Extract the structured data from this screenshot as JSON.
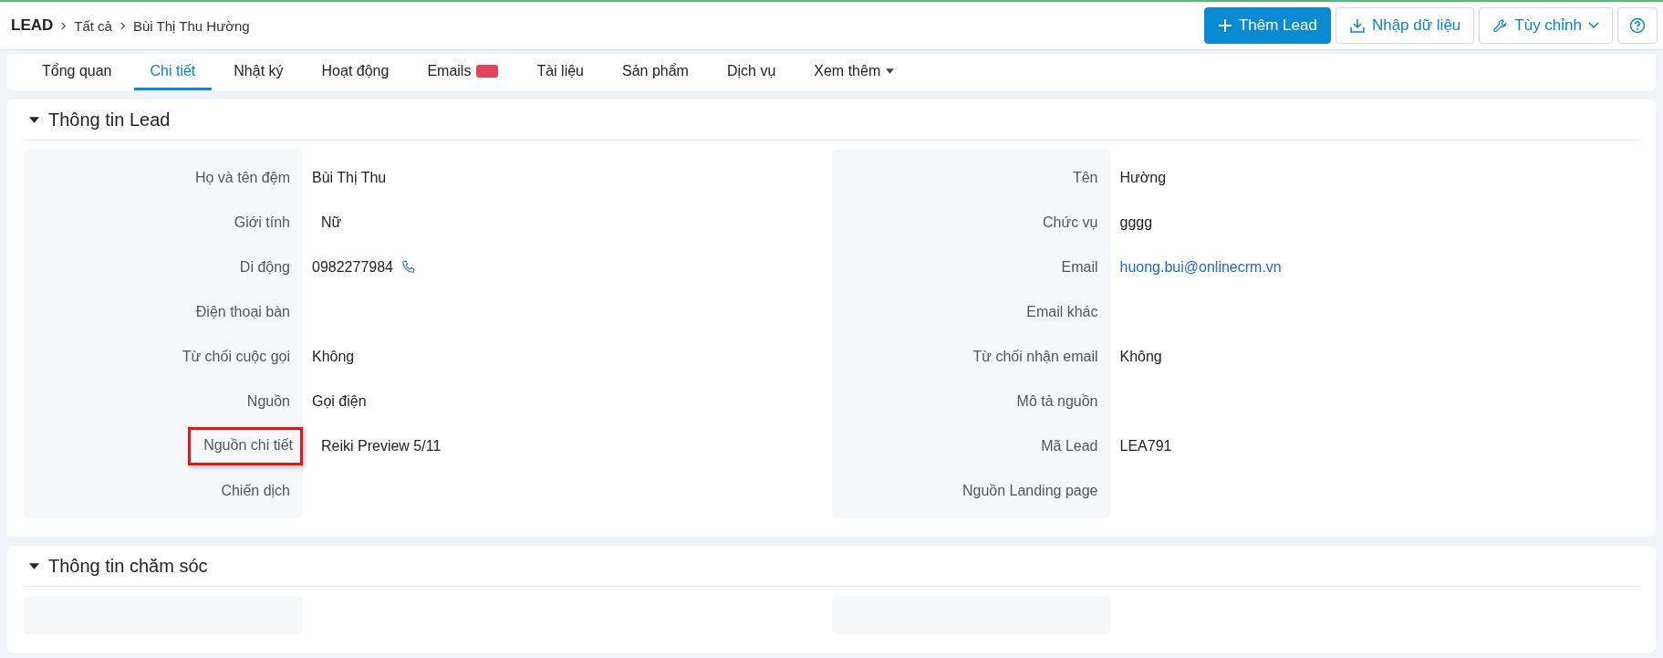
{
  "breadcrumb": {
    "module": "LEAD",
    "items": [
      "Tất cả",
      "Bùi Thị Thu Hường"
    ]
  },
  "actions": [
    {
      "kind": "add",
      "label": "Thêm Lead"
    },
    {
      "kind": "import",
      "label": "Nhập dữ liệu"
    },
    {
      "kind": "customize",
      "label": "Tùy chỉnh"
    },
    {
      "kind": "help"
    }
  ],
  "tabs": [
    {
      "label": "Tổng quan",
      "selected": false
    },
    {
      "label": "Chi tiết",
      "selected": true
    },
    {
      "label": "Nhật ký",
      "selected": false
    },
    {
      "label": "Hoạt động",
      "selected": false
    },
    {
      "label": "Emails",
      "selected": false,
      "badge": true
    },
    {
      "label": "Tài liệu",
      "selected": false
    },
    {
      "label": "Sản phẩm",
      "selected": false
    },
    {
      "label": "Dịch vụ",
      "selected": false
    },
    {
      "label": "Xem thêm",
      "selected": false,
      "dropdown": true
    }
  ],
  "sections": [
    {
      "title": "Thông tin Lead",
      "expanded": true,
      "columns": [
        [
          {
            "label": "Họ và tên đệm",
            "value": "Bùi Thị Thu",
            "kind": "text"
          },
          {
            "label": "Giới tính",
            "value": "Nữ",
            "kind": "select"
          },
          {
            "label": "Di động",
            "value": "0982277984",
            "kind": "phone"
          },
          {
            "label": "Điện thoại bàn"
          },
          {
            "label": "Từ chối cuộc gọi",
            "value": "Không",
            "kind": "text"
          },
          {
            "label": "Nguồn",
            "value": "Gọi điện",
            "kind": "text"
          },
          {
            "label": "Nguồn chi tiết",
            "value": "Reiki Preview 5/11",
            "kind": "select",
            "highlighted": true
          },
          {
            "label": "Chiến dịch"
          }
        ],
        [
          {
            "label": "Tên",
            "value": "Hường",
            "kind": "text"
          },
          {
            "label": "Chức vụ",
            "value": "gggg",
            "kind": "text"
          },
          {
            "label": "Email",
            "value": "huong.bui@onlinecrm.vn",
            "kind": "email"
          },
          {
            "label": "Email khác"
          },
          {
            "label": "Từ chối nhận email",
            "value": "Không",
            "kind": "text"
          },
          {
            "label": "Mô tả nguồn"
          },
          {
            "label": "Mã Lead",
            "value": "LEA791",
            "kind": "text"
          },
          {
            "label": "Nguồn Landing page"
          }
        ]
      ]
    },
    {
      "title": "Thông tin chăm sóc",
      "expanded": true,
      "columns": [
        [],
        []
      ]
    }
  ]
}
